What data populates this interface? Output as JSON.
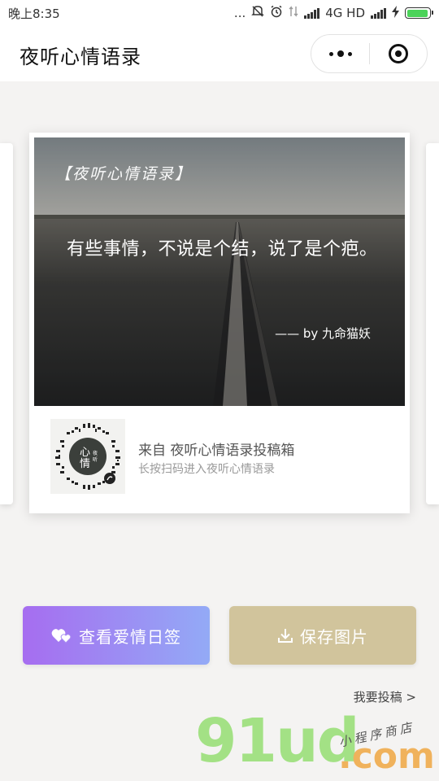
{
  "status_bar": {
    "time": "晚上8:35",
    "dots": "...",
    "network": "4G HD",
    "battery_level": 0.95
  },
  "nav": {
    "title": "夜听心情语录"
  },
  "card": {
    "brand_tag": "【夜听心情语录】",
    "quote": "有些事情，不说是个结，说了是个疤。",
    "author": "—— by 九命猫妖",
    "from_text": "来自 夜听心情语录投稿箱",
    "hint_text": "长按扫码进入夜听心情语录"
  },
  "buttons": {
    "love_label": "查看爱情日签",
    "save_label": "保存图片"
  },
  "submit_link": "我要投稿 >",
  "watermark": {
    "main": "91ud",
    "domain": ".com",
    "sub": "小程序商店"
  },
  "colors": {
    "love_gradient_start": "#a66df0",
    "love_gradient_end": "#93aaf6",
    "save_button": "#d1c49c",
    "battery": "#4cd35a"
  },
  "icons": {
    "love_button_icon": "hearts-icon",
    "save_button_icon": "download-icon",
    "capsule_more": "more-dots-icon",
    "capsule_close": "target-close-icon"
  }
}
